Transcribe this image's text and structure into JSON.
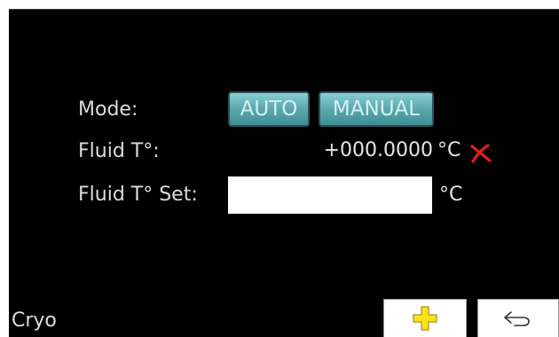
{
  "mode": {
    "label": "Mode:",
    "options": [
      "AUTO",
      "MANUAL"
    ]
  },
  "fluid_temp": {
    "label": "Fluid T°:",
    "value": "+000.0000",
    "unit": "°C",
    "status_icon": "red-x-icon"
  },
  "fluid_set": {
    "label": "Fluid T° Set:",
    "value": "",
    "unit": "°C"
  },
  "footer": {
    "title": "Cryo",
    "add_icon": "yellow-plus-icon",
    "back_icon": "return-arrow-icon"
  },
  "colors": {
    "background": "#000000",
    "text": "#dcdcdc",
    "button_teal": "#5dabb0",
    "error_red": "#e0201e",
    "plus_yellow": "#ffe21a"
  }
}
